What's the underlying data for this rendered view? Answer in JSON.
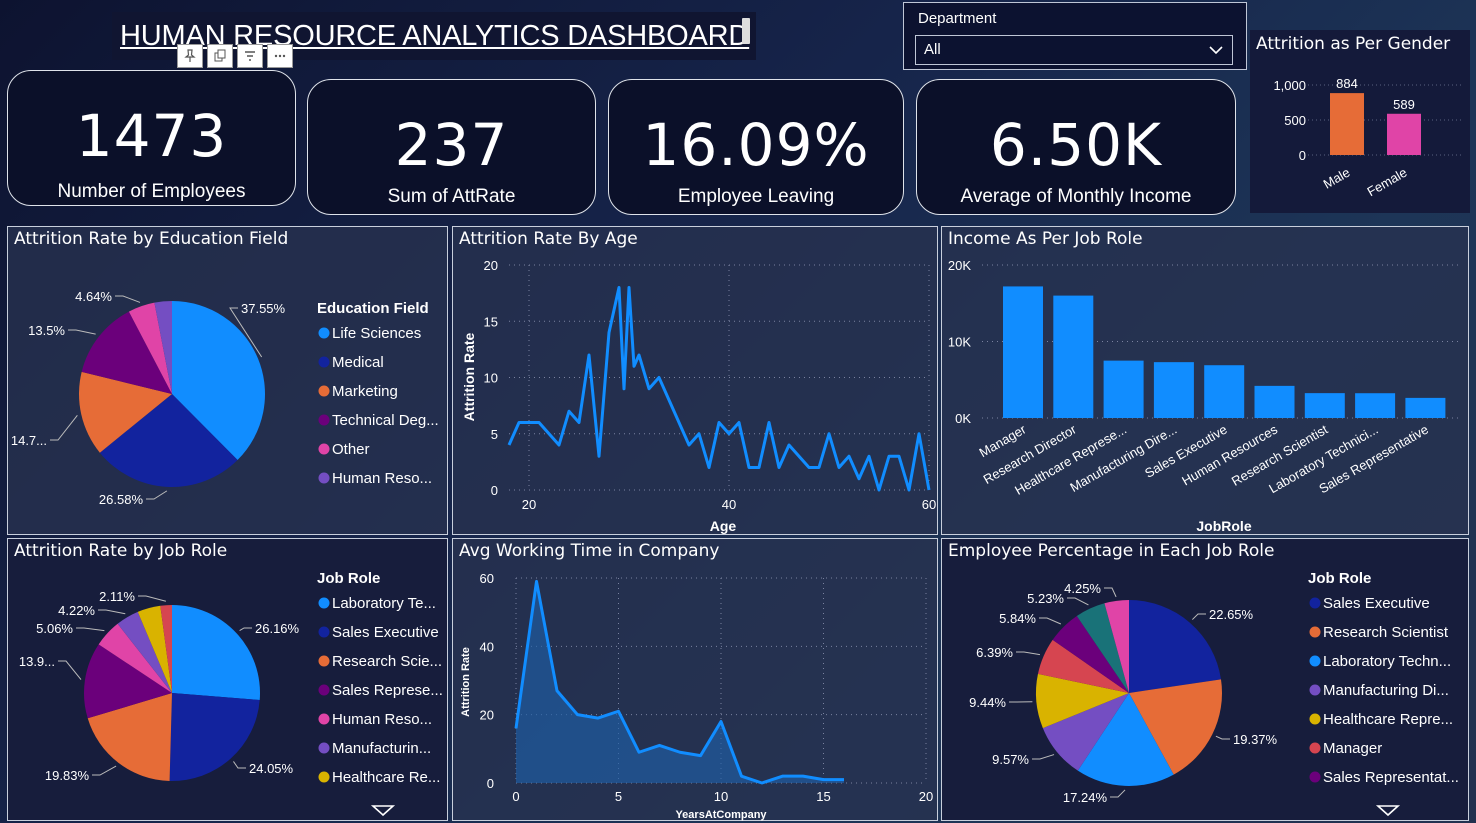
{
  "header": {
    "title": "HUMAN RESOURCE ANALYTICS DASHBOARD",
    "tools": [
      "pin-icon",
      "copy-icon",
      "filter-icon",
      "more-icon"
    ]
  },
  "filter": {
    "label": "Department",
    "selected": "All"
  },
  "kpis": [
    {
      "value": "1473",
      "label": "Number of Employees"
    },
    {
      "value": "237",
      "label": "Sum of AttRate"
    },
    {
      "value": "16.09%",
      "label": "Employee Leaving"
    },
    {
      "value": "6.50K",
      "label": "Average of Monthly Income"
    }
  ],
  "colors": {
    "blue": "#118dff",
    "navy": "#12239e",
    "orange": "#e66c37",
    "purple": "#6b007b",
    "pink": "#e044a7",
    "violet": "#744ec2",
    "yellow": "#d9b300",
    "red": "#d64550",
    "teal": "#197278",
    "maleBar": "#e66c37",
    "femaleBar": "#e044a7"
  },
  "chart_data": [
    {
      "id": "gender",
      "type": "bar",
      "title": "Attrition as Per Gender",
      "categories": [
        "Male",
        "Female"
      ],
      "values": [
        884,
        589
      ],
      "data_labels": [
        "884",
        "589"
      ],
      "y_ticks": [
        "1,000",
        "500",
        "0"
      ],
      "ylim": [
        0,
        1000
      ]
    },
    {
      "id": "education",
      "type": "pie",
      "title": "Attrition Rate by Education Field",
      "legend_title": "Education Field",
      "legend": [
        "Life Sciences",
        "Medical",
        "Marketing",
        "Technical Deg...",
        "Other",
        "Human Reso..."
      ],
      "values": [
        37.55,
        26.58,
        14.7,
        13.5,
        4.64,
        3.03
      ],
      "labels": [
        "37.55%",
        "26.58%",
        "14.7...",
        "13.5%",
        "4.64%",
        ""
      ]
    },
    {
      "id": "age",
      "type": "line",
      "title": "Attrition Rate By Age",
      "xlabel": "Age",
      "ylabel": "Attrition Rate",
      "xlim": [
        18,
        60
      ],
      "ylim": [
        0,
        20
      ],
      "x_ticks": [
        "20",
        "40",
        "60"
      ],
      "y_ticks": [
        "20",
        "15",
        "10",
        "5",
        "0"
      ],
      "x": [
        18,
        19,
        20,
        21,
        22,
        23,
        24,
        25,
        26,
        27,
        28,
        28.5,
        29,
        29.5,
        30,
        30.5,
        31,
        32,
        33,
        34,
        35,
        36,
        37,
        38,
        39,
        40,
        41,
        42,
        43,
        44,
        45,
        46,
        47,
        48,
        49,
        50,
        51,
        52,
        53,
        54,
        55,
        56,
        57,
        58,
        59,
        60
      ],
      "y": [
        4,
        6,
        6,
        6,
        5,
        4,
        7,
        6,
        12,
        3,
        14,
        16,
        18,
        9,
        18,
        11,
        12,
        9,
        10,
        8,
        6,
        4,
        5,
        2,
        6,
        5,
        6,
        2,
        2,
        6,
        2,
        4,
        3,
        2,
        2,
        5,
        2,
        3,
        1,
        3,
        0,
        3,
        3,
        0,
        5,
        0
      ]
    },
    {
      "id": "income",
      "type": "bar",
      "title": "Income As Per Job Role",
      "xlabel": "JobRole",
      "categories": [
        "Manager",
        "Research Director",
        "Healthcare Represe...",
        "Manufacturing Dire...",
        "Sales Executive",
        "Human Resources",
        "Research Scientist",
        "Laboratory Technici...",
        "Sales Representative"
      ],
      "values": [
        17200,
        16000,
        7500,
        7300,
        6900,
        4200,
        3250,
        3240,
        2630
      ],
      "y_ticks": [
        "20K",
        "10K",
        "0K"
      ],
      "ylim": [
        0,
        20000
      ]
    },
    {
      "id": "jobrole_attr",
      "type": "pie",
      "title": "Attrition Rate by Job Role",
      "legend_title": "Job Role",
      "legend": [
        "Laboratory Te...",
        "Sales Executive",
        "Research Scie...",
        "Sales Represe...",
        "Human Reso...",
        "Manufacturin...",
        "Healthcare Re..."
      ],
      "values": [
        26.16,
        24.05,
        19.83,
        13.9,
        5.06,
        4.22,
        4.22,
        2.11
      ],
      "labels": [
        "26.16%",
        "24.05%",
        "19.83%",
        "13.9...",
        "5.06%",
        "4.22%",
        "",
        "2.11%"
      ]
    },
    {
      "id": "years",
      "type": "area",
      "title": "Avg Working Time in Company",
      "xlabel": "YearsAtCompany",
      "ylabel": "Attrition Rate",
      "xlim": [
        0,
        20
      ],
      "ylim": [
        0,
        60
      ],
      "x_ticks": [
        "0",
        "5",
        "10",
        "15",
        "20"
      ],
      "y_ticks": [
        "60",
        "40",
        "20",
        "0"
      ],
      "x": [
        0,
        1,
        2,
        3,
        4,
        5,
        6,
        7,
        8,
        9,
        10,
        11,
        12,
        13,
        14,
        15,
        16
      ],
      "y": [
        16,
        59,
        27,
        20,
        19,
        21,
        9,
        11,
        9,
        8,
        18,
        2,
        0,
        2,
        2,
        1,
        1
      ]
    },
    {
      "id": "emp_pct",
      "type": "pie",
      "title": "Employee Percentage in Each Job Role",
      "legend_title": "Job Role",
      "legend": [
        "Sales Executive",
        "Research Scientist",
        "Laboratory Techn...",
        "Manufacturing Di...",
        "Healthcare Repre...",
        "Manager",
        "Sales Representat..."
      ],
      "values": [
        22.65,
        19.37,
        17.24,
        9.57,
        9.44,
        6.39,
        5.84,
        5.23,
        4.25
      ],
      "labels": [
        "22.65%",
        "19.37%",
        "17.24%",
        "9.57%",
        "9.44%",
        "6.39%",
        "5.84%",
        "5.23%",
        "4.25%"
      ]
    }
  ]
}
